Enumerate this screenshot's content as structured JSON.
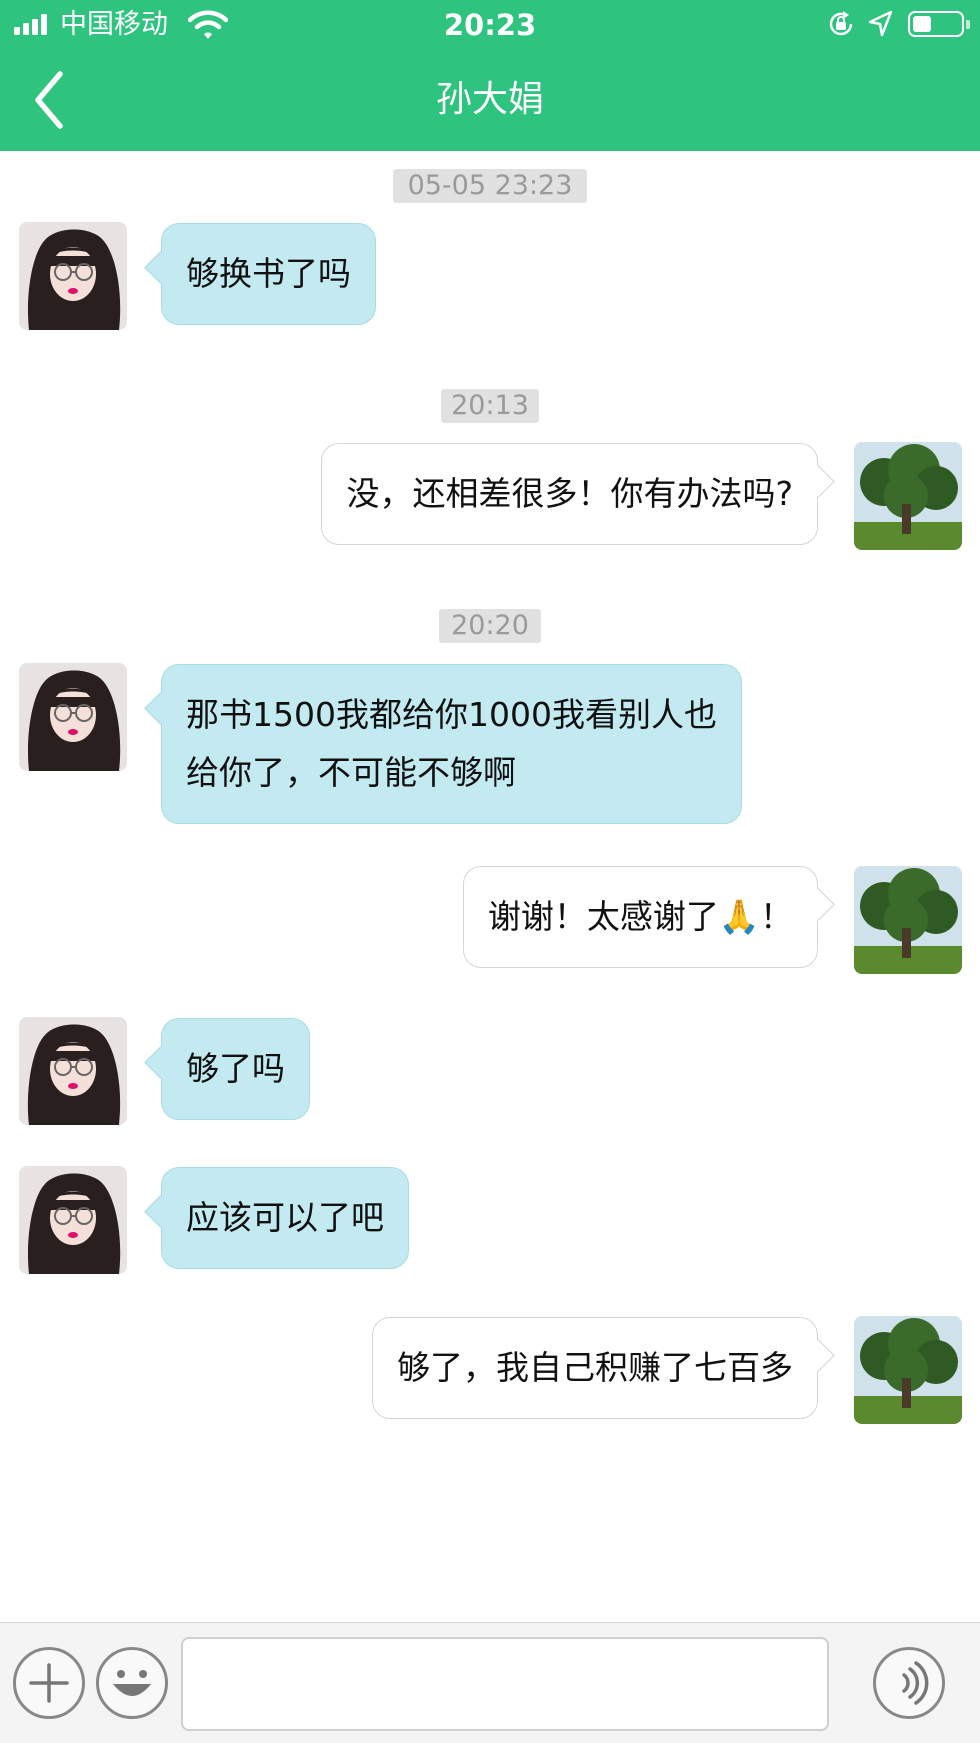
{
  "status_bar": {
    "carrier": "中国移动",
    "time": "20:23",
    "battery_level": 0.4
  },
  "nav": {
    "title": "孙大娟"
  },
  "messages": [
    {
      "type": "timestamp",
      "text": "05-05 23:23"
    },
    {
      "type": "message",
      "side": "left",
      "text": "够换书了吗"
    },
    {
      "type": "timestamp",
      "text": "20:13"
    },
    {
      "type": "message",
      "side": "right",
      "text": "没，还相差很多！你有办法吗?"
    },
    {
      "type": "timestamp",
      "text": "20:20"
    },
    {
      "type": "message",
      "side": "left",
      "lines": [
        "那书1500我都给你1000我看别人也",
        "给你了，不可能不够啊"
      ]
    },
    {
      "type": "message",
      "side": "right",
      "text": "谢谢！太感谢了🙏！"
    },
    {
      "type": "message",
      "side": "left",
      "text": "够了吗"
    },
    {
      "type": "message",
      "side": "left",
      "text": "应该可以了吧"
    },
    {
      "type": "message",
      "side": "right",
      "text": "够了，我自己积赚了七百多"
    }
  ],
  "input_bar": {
    "plus_icon": "plus-icon",
    "emoji_icon": "smiley-icon",
    "voice_icon": "voice-icon",
    "input_value": ""
  },
  "colors": {
    "header_green": "#2ec37e",
    "incoming_bubble": "#c3eaf0",
    "outgoing_bubble": "#ffffff",
    "timestamp_bg": "#e1e1e1"
  }
}
